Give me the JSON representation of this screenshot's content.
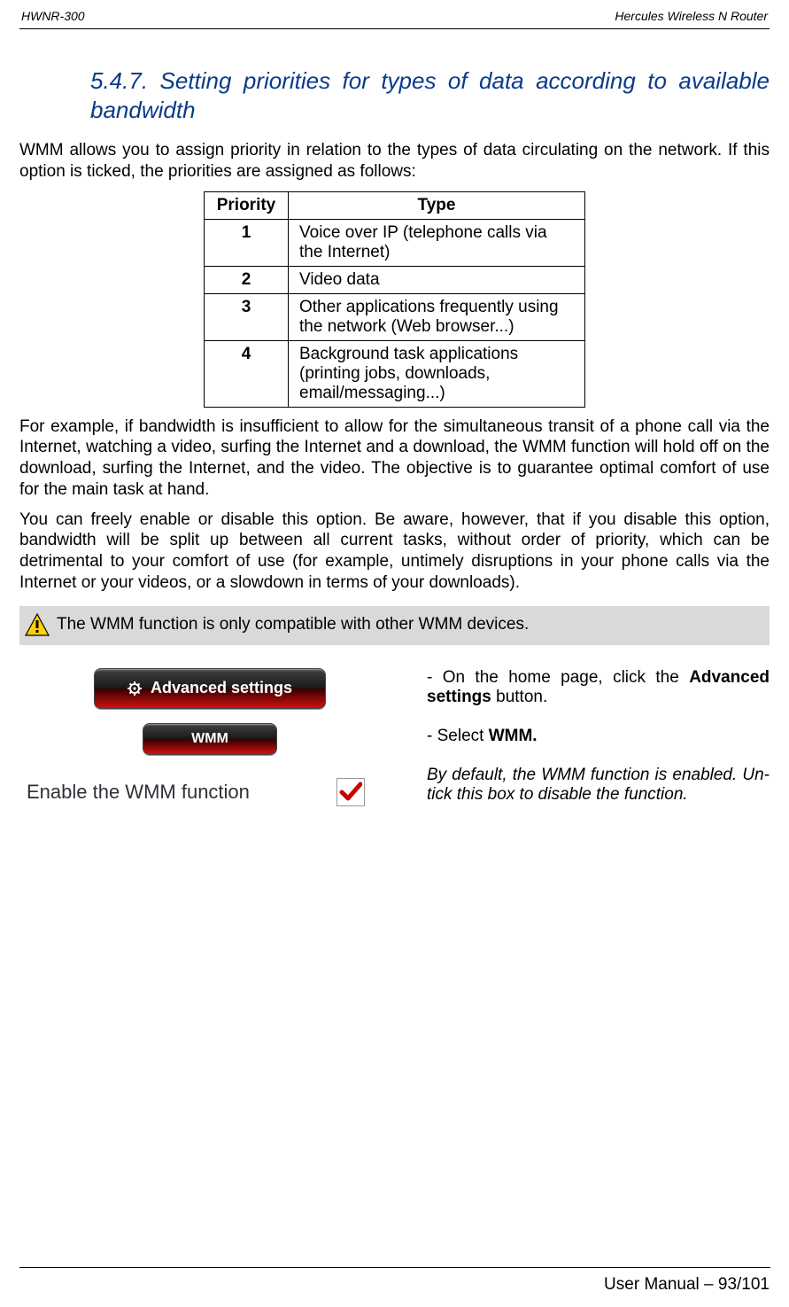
{
  "header": {
    "left": "HWNR-300",
    "right": "Hercules Wireless N Router"
  },
  "section": {
    "number": "5.4.7.",
    "title_full": "5.4.7. Setting priorities for types of data according to available bandwidth"
  },
  "paragraphs": {
    "intro": "WMM allows you to assign priority in relation to the types of data circulating on the network.  If this option is ticked, the priorities are assigned as follows:",
    "example": "For example, if bandwidth is insufficient to allow for the simultaneous transit of a phone call via the Internet, watching a video, surfing the Internet and a download, the WMM function will hold off on the download, surfing the Internet, and the video.  The objective is to guarantee optimal comfort of use for the main task at hand.",
    "disable_note": "You can freely enable or disable this option.  Be aware, however, that if you disable this option, bandwidth will be split up between all current tasks, without order of priority, which can be detrimental to your comfort of use (for example, untimely disruptions in your phone calls via the Internet or your videos, or a slowdown in terms of your downloads).",
    "callout": "The WMM function is only compatible with other WMM devices."
  },
  "table": {
    "headers": {
      "priority": "Priority",
      "type": "Type"
    },
    "rows": [
      {
        "priority": "1",
        "type": "Voice over IP (telephone calls via the Internet)"
      },
      {
        "priority": "2",
        "type": "Video data"
      },
      {
        "priority": "3",
        "type": "Other applications frequently using the network (Web browser...)"
      },
      {
        "priority": "4",
        "type": "Background task applications (printing jobs, downloads, email/messaging...)"
      }
    ]
  },
  "ui": {
    "advanced_button_label": "Advanced settings",
    "wmm_button_label": "WMM",
    "enable_label": "Enable the WMM function"
  },
  "steps": {
    "one_prefix": "- On the home page, click the ",
    "one_bold": "Advanced settings",
    "one_suffix": " button.",
    "two_prefix": "- Select ",
    "two_bold": "WMM.",
    "three": "By default, the WMM function is enabled.  Un-tick this box to disable the function."
  },
  "footer": {
    "text": "User Manual – 93/101"
  }
}
